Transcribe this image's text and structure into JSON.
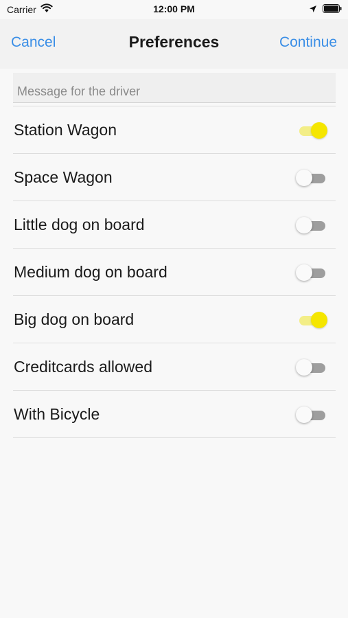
{
  "status_bar": {
    "carrier": "Carrier",
    "time": "12:00 PM"
  },
  "nav": {
    "cancel_label": "Cancel",
    "title": "Preferences",
    "continue_label": "Continue"
  },
  "message": {
    "placeholder": "Message for the driver",
    "value": ""
  },
  "preferences": [
    {
      "label": "Station Wagon",
      "enabled": true
    },
    {
      "label": "Space Wagon",
      "enabled": false
    },
    {
      "label": "Little dog on board",
      "enabled": false
    },
    {
      "label": "Medium dog on board",
      "enabled": false
    },
    {
      "label": "Big dog on board",
      "enabled": true
    },
    {
      "label": "Creditcards allowed",
      "enabled": false
    },
    {
      "label": "With Bicycle",
      "enabled": false
    }
  ],
  "colors": {
    "accent": "#3a8ee6",
    "toggle_on_thumb": "#f5e600",
    "toggle_on_track": "#f3ee87",
    "toggle_off_track": "#9e9e9e"
  },
  "icons": {
    "status_left": [
      "wifi-icon"
    ],
    "status_right": [
      "location-arrow-icon",
      "battery-icon"
    ]
  }
}
